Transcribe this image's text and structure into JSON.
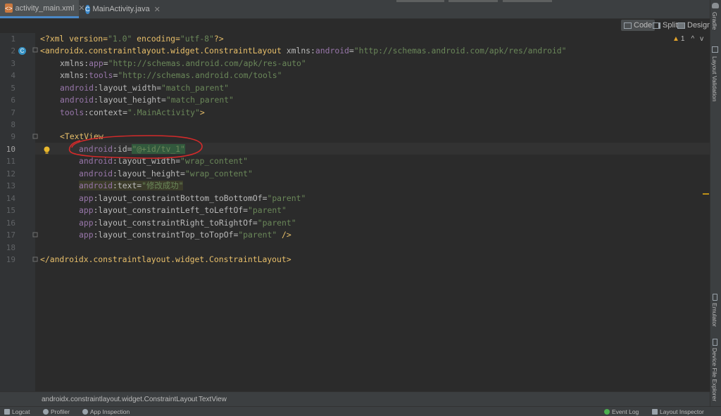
{
  "tabs": [
    {
      "label": "activity_main.xml",
      "icon": "xml-file-icon",
      "active": true
    },
    {
      "label": "MainActivity.java",
      "icon": "java-class-icon",
      "active": false
    }
  ],
  "view_modes": [
    {
      "label": "Code",
      "selected": true
    },
    {
      "label": "Split",
      "selected": false
    },
    {
      "label": "Design",
      "selected": false
    }
  ],
  "inspection": {
    "count": "1",
    "up": "^",
    "down": "v"
  },
  "right_tools": [
    "Gradle",
    "Layout Validation",
    "Emulator",
    "Device File Explorer"
  ],
  "line_numbers": [
    "1",
    "2",
    "3",
    "4",
    "5",
    "6",
    "7",
    "8",
    "9",
    "10",
    "11",
    "12",
    "13",
    "14",
    "15",
    "16",
    "17",
    "18",
    "19"
  ],
  "code": {
    "l1": {
      "a": "<?xml version=",
      "b": "\"1.0\"",
      "c": " encoding=",
      "d": "\"utf-8\"",
      "e": "?>"
    },
    "l2": {
      "a": "<androidx.constraintlayout.widget.ConstraintLayout",
      "b": " xmlns:",
      "c": "android",
      "d": "=",
      "e": "\"http://schemas.android.com/apk/res/android\""
    },
    "l3": {
      "a": "xmlns:",
      "b": "app",
      "c": "=",
      "d": "\"http://schemas.android.com/apk/res-auto\""
    },
    "l4": {
      "a": "xmlns:",
      "b": "tools",
      "c": "=",
      "d": "\"http://schemas.android.com/tools\""
    },
    "l5": {
      "a": "android",
      "b": ":layout_width=",
      "c": "\"match_parent\""
    },
    "l6": {
      "a": "android",
      "b": ":layout_height=",
      "c": "\"match_parent\""
    },
    "l7": {
      "a": "tools",
      "b": ":context=",
      "c": "\".MainActivity\"",
      "d": ">"
    },
    "l9": {
      "a": "<TextView"
    },
    "l10": {
      "a": "android",
      "b": ":id=",
      "c": "\"@+id/tv_1\""
    },
    "l11": {
      "a": "android",
      "b": ":layout_width=",
      "c": "\"wrap_content\""
    },
    "l12": {
      "a": "android",
      "b": ":layout_height=",
      "c": "\"wrap_content\""
    },
    "l13": {
      "a": "android",
      "b": ":text=",
      "c": "\"修改成功\""
    },
    "l14": {
      "a": "app",
      "b": ":layout_constraintBottom_toBottomOf=",
      "c": "\"parent\""
    },
    "l15": {
      "a": "app",
      "b": ":layout_constraintLeft_toLeftOf=",
      "c": "\"parent\""
    },
    "l16": {
      "a": "app",
      "b": ":layout_constraintRight_toRightOf=",
      "c": "\"parent\""
    },
    "l17": {
      "a": "app",
      "b": ":layout_constraintTop_toTopOf=",
      "c": "\"parent\"",
      "d": " />"
    },
    "l19": {
      "a": "</androidx.constraintlayout.widget.ConstraintLayout>"
    }
  },
  "breadcrumb": [
    "androidx.constraintlayout.widget.ConstraintLayout",
    "TextView"
  ],
  "bottom_tools": {
    "logcat": "Logcat",
    "profiler": "Profiler",
    "app_inspection": "App Inspection",
    "event_log": "Event Log",
    "layout_inspector": "Layout Inspector"
  },
  "colors": {
    "annotation_circle": "#d42a2a",
    "tag": "#e8bf6a",
    "namespace": "#9876aa",
    "string": "#6a8759"
  }
}
